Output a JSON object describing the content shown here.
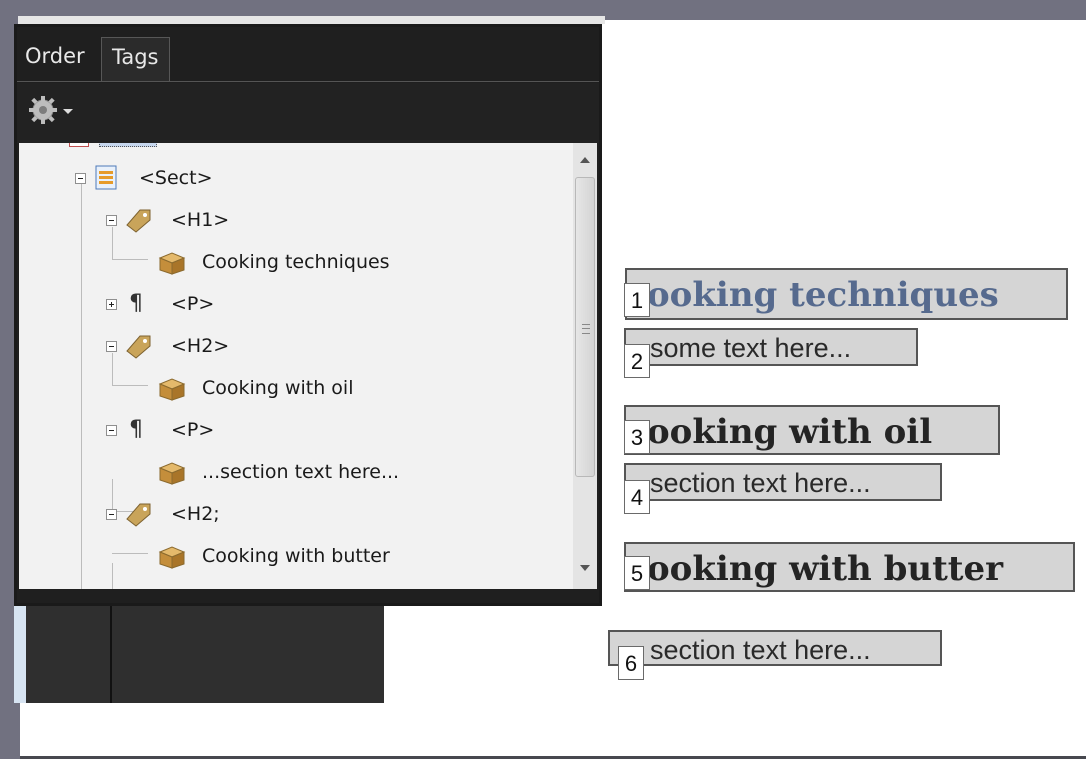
{
  "panel": {
    "tabs": [
      {
        "label": "Order"
      },
      {
        "label": "Tags"
      }
    ],
    "options_icon": "gear-icon",
    "tree": [
      {
        "label": "<Sect>",
        "icon": "section-icon"
      },
      {
        "label": "<H1>",
        "icon": "tag-icon"
      },
      {
        "label": "Cooking techniques",
        "icon": "content-box-icon"
      },
      {
        "label": "<P>",
        "icon": "paragraph-icon"
      },
      {
        "label": "<H2>",
        "icon": "tag-icon"
      },
      {
        "label": "Cooking with oil",
        "icon": "content-box-icon"
      },
      {
        "label": "<P>",
        "icon": "paragraph-icon"
      },
      {
        "label": "...section text here...",
        "icon": "content-box-icon"
      },
      {
        "label": "<H2;",
        "icon": "tag-icon"
      },
      {
        "label": "Cooking with butter",
        "icon": "content-box-icon"
      }
    ]
  },
  "page": {
    "items": [
      {
        "order": "1",
        "text": "ooking techniques"
      },
      {
        "order": "2",
        "text": "some text here..."
      },
      {
        "order": "3",
        "text": "ooking with oil"
      },
      {
        "order": "4",
        "text": "section text here..."
      },
      {
        "order": "5",
        "text": "ooking with butter"
      },
      {
        "order": "6",
        "text": "section text here..."
      }
    ]
  },
  "colors": {
    "heading1": "#566a8e",
    "heading2": "#242424",
    "box_fill": "#d5d5d5",
    "panel_dark": "#1f1f1f"
  }
}
